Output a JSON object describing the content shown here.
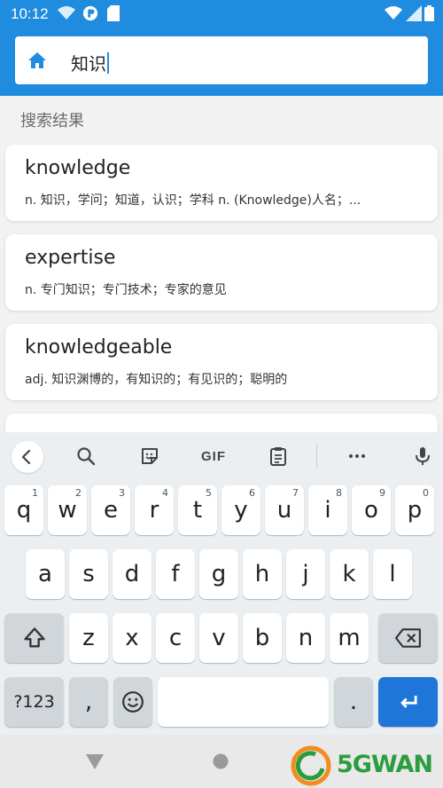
{
  "status_bar": {
    "time": "10:12",
    "icons": [
      "wifi-icon",
      "notification-app-icon",
      "sd-card-icon",
      "wifi-signal-icon",
      "cellular-signal-icon",
      "battery-icon"
    ]
  },
  "search": {
    "query": "知识",
    "home_icon": "home-icon"
  },
  "results": {
    "title": "搜索结果",
    "items": [
      {
        "word": "knowledge",
        "definition": "n. 知识，学问；知道，认识；学科 n. (Knowledge)人名；..."
      },
      {
        "word": "expertise",
        "definition": "n. 专门知识；专门技术；专家的意见"
      },
      {
        "word": "knowledgeable",
        "definition": "adj. 知识渊博的，有知识的；有见识的；聪明的"
      }
    ]
  },
  "keyboard": {
    "toolbar": {
      "gif_label": "GIF",
      "icons": [
        "back-chevron-icon",
        "search-icon",
        "sticker-icon",
        "clipboard-icon",
        "more-icon",
        "microphone-icon"
      ]
    },
    "row1": [
      {
        "k": "q",
        "h": "1"
      },
      {
        "k": "w",
        "h": "2"
      },
      {
        "k": "e",
        "h": "3"
      },
      {
        "k": "r",
        "h": "4"
      },
      {
        "k": "t",
        "h": "5"
      },
      {
        "k": "y",
        "h": "6"
      },
      {
        "k": "u",
        "h": "7"
      },
      {
        "k": "i",
        "h": "8"
      },
      {
        "k": "o",
        "h": "9"
      },
      {
        "k": "p",
        "h": "0"
      }
    ],
    "row2": [
      "a",
      "s",
      "d",
      "f",
      "g",
      "h",
      "j",
      "k",
      "l"
    ],
    "row3": [
      "z",
      "x",
      "c",
      "v",
      "b",
      "n",
      "m"
    ],
    "symbols_label": "?123",
    "comma_label": ",",
    "period_label": "."
  },
  "watermark": {
    "text": "5GWAN"
  },
  "colors": {
    "app_bar": "#1f8ce0",
    "enter_key": "#1e76d8",
    "watermark": "#2a9d3e"
  }
}
